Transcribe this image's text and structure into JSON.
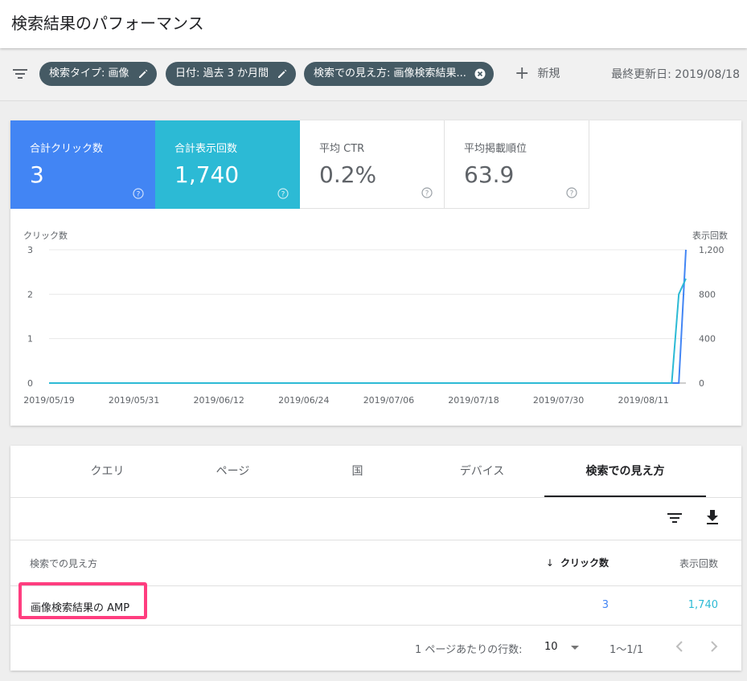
{
  "header": {
    "title": "検索結果のパフォーマンス"
  },
  "filters": {
    "chips": [
      {
        "label": "検索タイプ: 画像",
        "icon": "pencil-icon"
      },
      {
        "label": "日付: 過去 3 か月間",
        "icon": "pencil-icon"
      },
      {
        "label": "検索での見え方: 画像検索結果...",
        "icon": "close-circle-icon"
      }
    ],
    "new_label": "新規",
    "last_updated": "最終更新日: 2019/08/18"
  },
  "metrics": [
    {
      "label": "合計クリック数",
      "value": "3",
      "color": "#4285f4"
    },
    {
      "label": "合計表示回数",
      "value": "1,740",
      "color": "#2cbad5"
    },
    {
      "label": "平均 CTR",
      "value": "0.2%"
    },
    {
      "label": "平均掲載順位",
      "value": "63.9"
    }
  ],
  "chart_data": {
    "type": "line",
    "left_axis_label": "クリック数",
    "right_axis_label": "表示回数",
    "left_ticks": [
      "3",
      "2",
      "1",
      "0"
    ],
    "right_ticks": [
      "1,200",
      "800",
      "400",
      "0"
    ],
    "left_ylim": [
      0,
      3
    ],
    "right_ylim": [
      0,
      1200
    ],
    "x_ticks": [
      "2019/05/19",
      "2019/05/31",
      "2019/06/12",
      "2019/06/24",
      "2019/07/06",
      "2019/07/18",
      "2019/07/30",
      "2019/08/11"
    ],
    "x_range": [
      "2019/05/19",
      "2019/08/17"
    ],
    "series": [
      {
        "axis": "left",
        "color": "#4285f4",
        "points": [
          [
            "2019/05/19",
            0
          ],
          [
            "2019/08/16",
            0
          ],
          [
            "2019/08/17",
            3
          ]
        ]
      },
      {
        "axis": "right",
        "color": "#2cbad5",
        "points": [
          [
            "2019/05/19",
            0
          ],
          [
            "2019/08/15",
            0
          ],
          [
            "2019/08/16",
            800
          ],
          [
            "2019/08/17",
            940
          ]
        ]
      }
    ]
  },
  "table": {
    "tabs": [
      "クエリ",
      "ページ",
      "国",
      "デバイス",
      "検索での見え方"
    ],
    "active_tab": 4,
    "columns": {
      "name": "検索での見え方",
      "clicks": "クリック数",
      "impressions": "表示回数"
    },
    "rows": [
      {
        "name": "画像検索結果の AMP",
        "clicks": "3",
        "impressions": "1,740"
      }
    ],
    "pagination": {
      "rows_per_page_label": "1 ページあたりの行数:",
      "rows_per_page": "10",
      "range": "1〜1/1"
    }
  }
}
